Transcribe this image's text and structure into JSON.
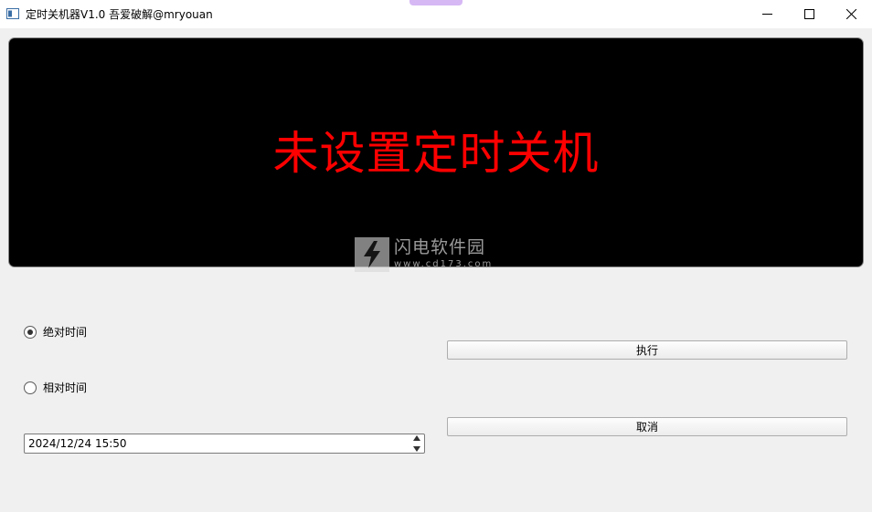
{
  "window": {
    "title": "定时关机器V1.0 吾爱破解@mryouan"
  },
  "display": {
    "status_text": "未设置定时关机",
    "status_color": "#ff0000"
  },
  "watermark": {
    "name": "闪电软件园",
    "url": "www.cd173.com"
  },
  "mode": {
    "absolute_label": "绝对时间",
    "relative_label": "相对时间",
    "selected": "absolute"
  },
  "buttons": {
    "execute_label": "执行",
    "cancel_label": "取消"
  },
  "datetime": {
    "value": "2024/12/24 15:50"
  }
}
